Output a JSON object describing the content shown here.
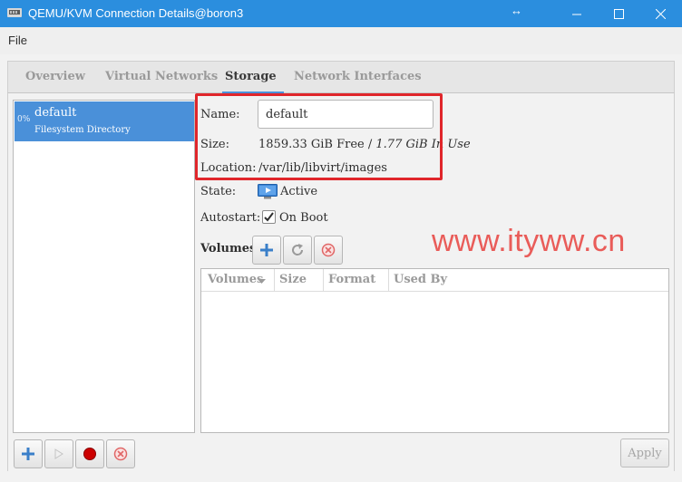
{
  "window": {
    "title": "QEMU/KVM Connection Details@boron3",
    "resize_glyph": "↔"
  },
  "menu": {
    "file": "File"
  },
  "tabs": [
    {
      "label": "Overview"
    },
    {
      "label": "Virtual Networks"
    },
    {
      "label": "Storage"
    },
    {
      "label": "Network Interfaces"
    }
  ],
  "active_tab": "Storage",
  "pools": [
    {
      "usage": "0%",
      "name": "default",
      "type": "Filesystem Directory"
    }
  ],
  "details": {
    "name_label": "Name:",
    "name_value": "default",
    "size_label": "Size:",
    "size_free": "1859.33 GiB Free / ",
    "size_inuse": "1.77 GiB In Use",
    "location_label": "Location:",
    "location_value": "/var/lib/libvirt/images",
    "state_label": "State:",
    "state_value": "Active",
    "autostart_label": "Autostart:",
    "autostart_value": "On Boot",
    "autostart_checked": true
  },
  "volumes": {
    "heading": "Volumes",
    "columns": [
      "Volumes",
      "Size",
      "Format",
      "Used By"
    ],
    "rows": []
  },
  "apply_label": "Apply",
  "watermark": "www.ityww.cn",
  "colors": {
    "titlebar": "#2b8ede",
    "selection": "#4a90d9",
    "highlight_box": "#e0262b",
    "add_icon": "#3a7fc9",
    "stop_icon": "#cc0000",
    "delete_icon": "#e06666"
  }
}
